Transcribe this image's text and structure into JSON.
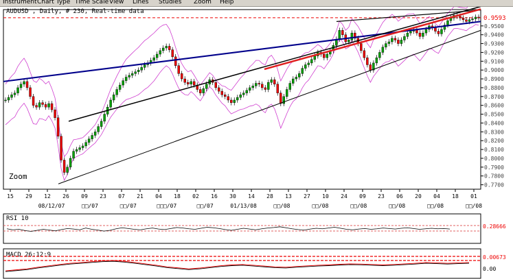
{
  "menu": [
    "Instrument",
    "Chart Type",
    "Time Scale",
    "View",
    "Lines",
    "Studies",
    "Zoom",
    "Help"
  ],
  "chart_data": [
    {
      "type": "line",
      "title": "AUDUSD , Daily, # 230, Real-time data",
      "watermark": "Zoom",
      "ylim": [
        0.765,
        0.9685
      ],
      "y_ticks": [
        "0.9500",
        "0.9400",
        "0.9300",
        "0.9200",
        "0.9100",
        "0.9000",
        "0.8900",
        "0.8800",
        "0.8700",
        "0.8600",
        "0.8500",
        "0.8400",
        "0.8300",
        "0.8200",
        "0.8100",
        "0.8000",
        "0.7900",
        "0.7800",
        "0.7700"
      ],
      "last_price_label": "0.9593",
      "x_day_labels": [
        "15",
        "29",
        "12",
        "26",
        "09",
        "23",
        "07",
        "21",
        "04",
        "18",
        "02",
        "16",
        "30",
        "14",
        "28",
        "13",
        "27",
        "10",
        "24",
        "09",
        "23",
        "06",
        "20",
        "04",
        "18",
        "01"
      ],
      "x_month_labels": [
        "08/12/07",
        "\u0000\u0000/07",
        "\u0000\u0000/07",
        "\u0000\u0000\u0000/07",
        "\u0000\u0000/07",
        "01/13/08",
        "\u0000\u0000/08",
        "\u0000\u0000/08",
        "\u0000\u0000/08",
        "\u0000\u0000/08",
        "\u0000\u0000/08",
        "\u0000\u0000/08"
      ],
      "series": [
        {
          "name": "",
          "values": [
            0.866,
            0.869,
            0.872,
            0.874,
            0.88,
            0.884,
            0.887,
            0.88,
            0.87,
            0.86,
            0.858,
            0.863,
            0.861,
            0.858,
            0.862,
            0.855,
            0.846,
            0.825,
            0.798,
            0.784,
            0.79,
            0.8,
            0.808,
            0.81,
            0.812,
            0.814,
            0.818,
            0.822,
            0.826,
            0.83,
            0.836,
            0.842,
            0.85,
            0.858,
            0.866,
            0.872,
            0.878,
            0.883,
            0.888,
            0.892,
            0.894,
            0.896,
            0.898,
            0.9,
            0.903,
            0.906,
            0.908,
            0.911,
            0.914,
            0.918,
            0.922,
            0.925,
            0.927,
            0.923,
            0.915,
            0.905,
            0.896,
            0.89,
            0.886,
            0.884,
            0.887,
            0.883,
            0.878,
            0.874,
            0.879,
            0.884,
            0.889,
            0.886,
            0.88,
            0.876,
            0.872,
            0.87,
            0.866,
            0.863,
            0.866,
            0.869,
            0.872,
            0.874,
            0.877,
            0.88,
            0.882,
            0.885,
            0.884,
            0.88,
            0.878,
            0.886,
            0.889,
            0.884,
            0.874,
            0.862,
            0.87,
            0.878,
            0.885,
            0.89,
            0.892,
            0.896,
            0.902,
            0.906,
            0.908,
            0.912,
            0.916,
            0.92,
            0.918,
            0.914,
            0.918,
            0.922,
            0.928,
            0.935,
            0.945,
            0.94,
            0.932,
            0.934,
            0.942,
            0.936,
            0.93,
            0.922,
            0.914,
            0.906,
            0.9,
            0.908,
            0.914,
            0.92,
            0.926,
            0.93,
            0.932,
            0.936,
            0.934,
            0.93,
            0.934,
            0.938,
            0.942,
            0.944,
            0.946,
            0.942,
            0.938,
            0.942,
            0.946,
            0.95,
            0.948,
            0.944,
            0.941,
            0.946,
            0.951,
            0.956,
            0.959,
            0.962,
            0.961,
            0.959,
            0.957,
            0.955,
            0.957,
            0.958,
            0.96,
            0.959
          ]
        }
      ]
    },
    {
      "type": "line",
      "title": "RSI 10",
      "level_label": "0.28666",
      "series": [
        {
          "name": "",
          "values": [
            0.52,
            0.48,
            0.5,
            0.45,
            0.42,
            0.46,
            0.5,
            0.47,
            0.44,
            0.49,
            0.53,
            0.51,
            0.48,
            0.55,
            0.5,
            0.47,
            0.43,
            0.46,
            0.52,
            0.56,
            0.53,
            0.5,
            0.48,
            0.52,
            0.55,
            0.51,
            0.49,
            0.53,
            0.57,
            0.55,
            0.52,
            0.5,
            0.54,
            0.58,
            0.56,
            0.53,
            0.49,
            0.46,
            0.5,
            0.54,
            0.51,
            0.48,
            0.52,
            0.55,
            0.57,
            0.6,
            0.56,
            0.52,
            0.49,
            0.47,
            0.51,
            0.54,
            0.52,
            0.55,
            0.58,
            0.54,
            0.5,
            0.48,
            0.51,
            0.53,
            0.5,
            0.52,
            0.55,
            0.53,
            0.51,
            0.54,
            0.56,
            0.53,
            0.5,
            0.52,
            0.54,
            0.52,
            0.53,
            0.51
          ]
        }
      ]
    },
    {
      "type": "line",
      "title": "MACD 26:12:9",
      "level_label": "0.00673",
      "zero_label": "0.00",
      "series": [
        {
          "name": "",
          "values": [
            0.2,
            0.25,
            0.3,
            0.38,
            0.45,
            0.52,
            0.58,
            0.62,
            0.66,
            0.7,
            0.72,
            0.68,
            0.62,
            0.55,
            0.48,
            0.4,
            0.35,
            0.3,
            0.34,
            0.4,
            0.46,
            0.5,
            0.52,
            0.48,
            0.44,
            0.4,
            0.38,
            0.42,
            0.45,
            0.48,
            0.5,
            0.53,
            0.55,
            0.54,
            0.52,
            0.5,
            0.52,
            0.55,
            0.58,
            0.62,
            0.6,
            0.58,
            0.6,
            0.62
          ]
        }
      ]
    }
  ]
}
